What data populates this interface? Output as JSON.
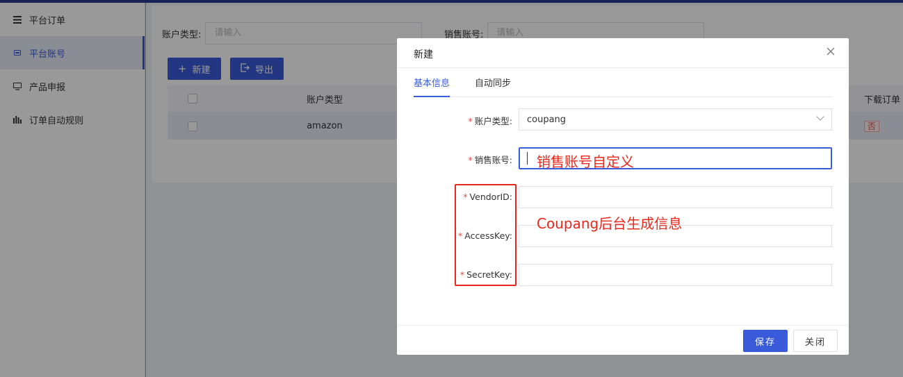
{
  "sidebar": {
    "items": [
      {
        "label": "平台订单",
        "icon": "menu-icon"
      },
      {
        "label": "平台账号",
        "icon": "card-icon",
        "active": true
      },
      {
        "label": "产品申报",
        "icon": "monitor-icon"
      },
      {
        "label": "订单自动规则",
        "icon": "bars-icon"
      }
    ]
  },
  "filters": {
    "account_type_label": "账户类型:",
    "account_type_placeholder": "请输入",
    "sales_account_label": "销售账号:",
    "sales_account_placeholder": "请输入"
  },
  "toolbar": {
    "new_label": "新建",
    "export_label": "导出"
  },
  "table": {
    "headers": [
      "账户类型",
      "下载订单"
    ],
    "rows": [
      {
        "account_type": "amazon",
        "download": "否"
      }
    ]
  },
  "modal": {
    "title": "新建",
    "tabs": [
      "基本信息",
      "自动同步"
    ],
    "fields": {
      "account_type_label": "账户类型:",
      "account_type_value": "coupang",
      "sales_account_label": "销售账号:",
      "vendor_id_label": "VendorID:",
      "access_key_label": "AccessKey:",
      "secret_key_label": "SecretKey:"
    },
    "annotations": {
      "sales_account_hint": "销售账号自定义",
      "coupang_hint": "Coupang后台生成信息"
    },
    "footer": {
      "save_label": "保存",
      "close_label": "关闭"
    }
  },
  "colors": {
    "primary": "#3a5bd9",
    "annotation_red": "#e8281c"
  }
}
